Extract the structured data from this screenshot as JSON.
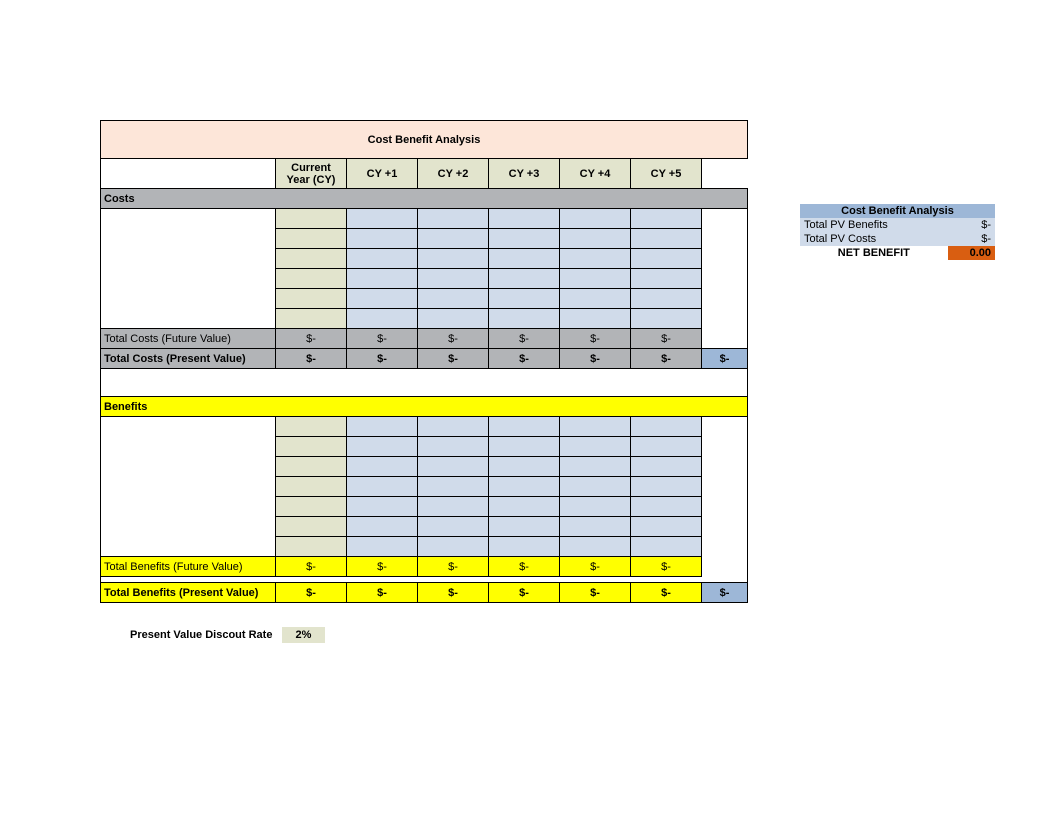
{
  "title": "Cost Benefit Analysis",
  "headers": [
    "Current Year (CY)",
    "CY +1",
    "CY +2",
    "CY +3",
    "CY +4",
    "CY +5"
  ],
  "costs": {
    "section_label": "Costs",
    "total_fv_label": "Total Costs (Future Value)",
    "total_pv_label": "Total Costs (Present Value)",
    "fv_values": [
      "$-",
      "$-",
      "$-",
      "$-",
      "$-",
      "$-"
    ],
    "pv_values": [
      "$-",
      "$-",
      "$-",
      "$-",
      "$-",
      "$-"
    ],
    "pv_sum": "$-"
  },
  "benefits": {
    "section_label": "Benefits",
    "total_fv_label": "Total Benefits (Future Value)",
    "total_pv_label": "Total Benefits (Present Value)",
    "fv_values": [
      "$-",
      "$-",
      "$-",
      "$-",
      "$-",
      "$-"
    ],
    "pv_values": [
      "$-",
      "$-",
      "$-",
      "$-",
      "$-",
      "$-"
    ],
    "pv_sum": "$-"
  },
  "discount": {
    "label": "Present Value Discout Rate",
    "value": "2%"
  },
  "summary": {
    "title": "Cost Benefit Analysis",
    "pv_benefits_label": "Total PV Benefits",
    "pv_benefits_value": "$-",
    "pv_costs_label": "Total PV Costs",
    "pv_costs_value": "$-",
    "net_label": "NET BENEFIT",
    "net_value": "0.00"
  }
}
